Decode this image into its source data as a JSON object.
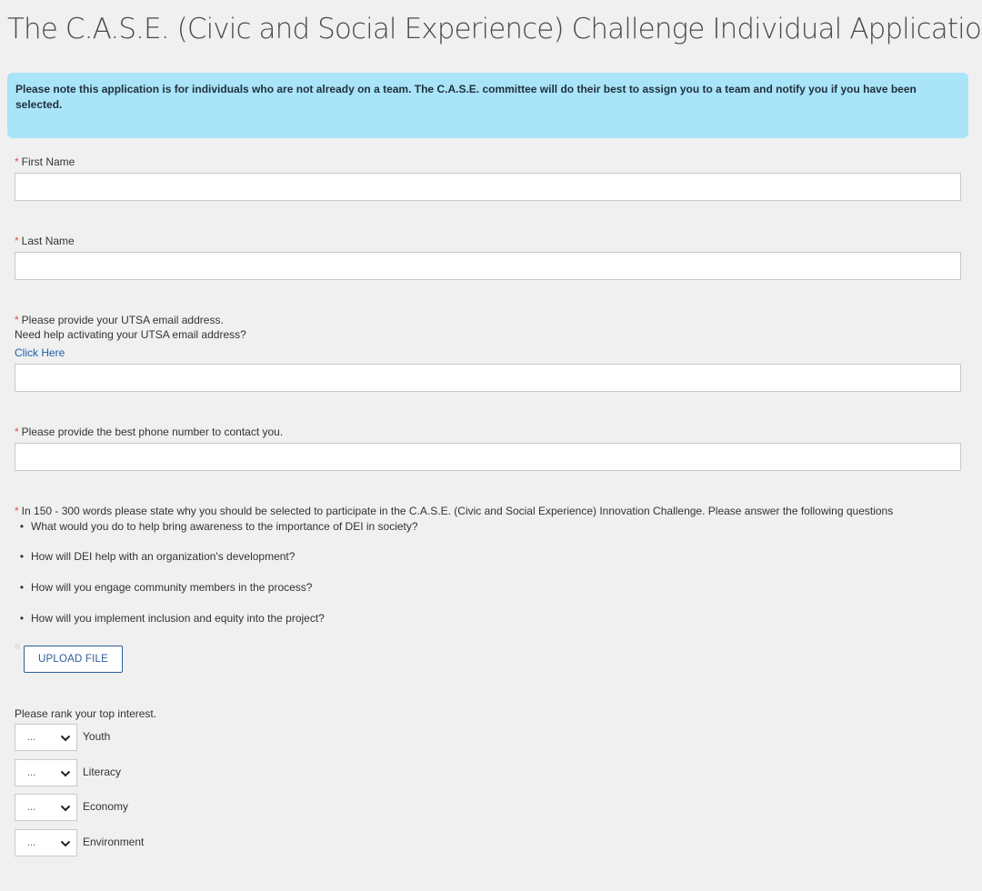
{
  "form": {
    "title": "The C.A.S.E. (Civic and Social Experience) Challenge Individual Application",
    "notice": "Please note this application is for individuals who are not already on a team. The C.A.S.E. committee will do their best to assign you to a team and notify you if you have been selected.",
    "required_marker": "*"
  },
  "fields": {
    "first_name": {
      "label": "First Name",
      "value": ""
    },
    "last_name": {
      "label": "Last Name",
      "value": ""
    },
    "email": {
      "label": "Please provide your UTSA email address.",
      "help": "Need help activating your UTSA email address?",
      "link": "Click Here",
      "value": ""
    },
    "phone": {
      "label": "Please provide the best phone number to contact you.",
      "value": ""
    }
  },
  "essay": {
    "prompt": "In 150 - 300 words please state why you should be selected to participate in the C.A.S.E. (Civic and Social Experience) Innovation Challenge. Please answer the following questions",
    "bullet_glyph": "•",
    "questions": [
      "What would you do to help bring awareness to the importance of DEI in society?",
      "How will DEI help with an organization's development?",
      "How will you engage community members in the process?",
      "How will you implement inclusion and equity into the project?"
    ],
    "upload_label": "UPLOAD FILE"
  },
  "ranking": {
    "label": "Please rank your top interest.",
    "items": [
      {
        "select_value": "...",
        "label": "Youth"
      },
      {
        "select_value": "...",
        "label": "Literacy"
      },
      {
        "select_value": "...",
        "label": "Economy"
      },
      {
        "select_value": "...",
        "label": "Environment"
      }
    ]
  },
  "icons": {
    "select_chevron": "chevron-down-icon"
  },
  "colors": {
    "page_background": "#f0f0f0",
    "notice_background": "#a9e4f9",
    "required_marker": "#d9534f",
    "link": "#1b5fa8",
    "upload_button": "#2b5d9c"
  }
}
